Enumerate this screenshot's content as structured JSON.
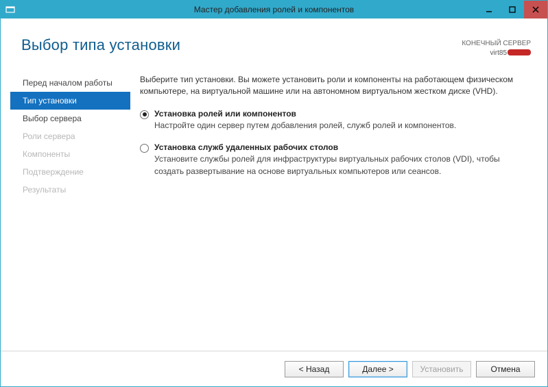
{
  "window": {
    "title": "Мастер добавления ролей и компонентов"
  },
  "header": {
    "page_title": "Выбор типа установки",
    "server_label": "КОНЕЧНЫЙ СЕРВЕР",
    "server_name_visible": "virt85"
  },
  "sidebar": {
    "items": [
      {
        "label": "Перед началом работы",
        "state": "normal"
      },
      {
        "label": "Тип установки",
        "state": "active"
      },
      {
        "label": "Выбор сервера",
        "state": "normal"
      },
      {
        "label": "Роли сервера",
        "state": "disabled"
      },
      {
        "label": "Компоненты",
        "state": "disabled"
      },
      {
        "label": "Подтверждение",
        "state": "disabled"
      },
      {
        "label": "Результаты",
        "state": "disabled"
      }
    ]
  },
  "body": {
    "intro": "Выберите тип установки. Вы можете установить роли и компоненты на работающем физическом компьютере, на виртуальной машине или на автономном виртуальном жестком диске (VHD).",
    "options": [
      {
        "title": "Установка ролей или компонентов",
        "desc": "Настройте один сервер путем добавления ролей, служб ролей и компонентов.",
        "selected": true
      },
      {
        "title": "Установка служб удаленных рабочих столов",
        "desc": "Установите службы ролей для инфраструктуры виртуальных рабочих столов (VDI), чтобы создать развертывание на основе виртуальных компьютеров или сеансов.",
        "selected": false
      }
    ]
  },
  "footer": {
    "back": "< Назад",
    "next": "Далее >",
    "install": "Установить",
    "cancel": "Отмена"
  }
}
